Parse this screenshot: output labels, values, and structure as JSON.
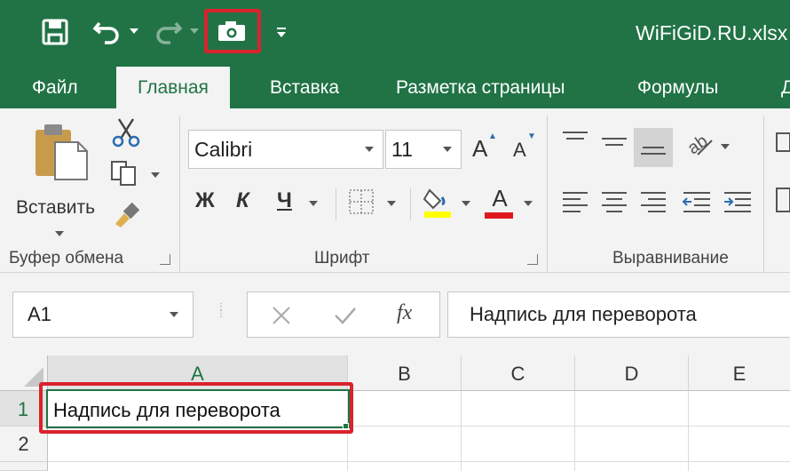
{
  "window": {
    "title": "WiFiGiD.RU.xlsx",
    "accent_color": "#217346",
    "highlight_color": "#d9232d"
  },
  "quick_access": {
    "icons": [
      "save-icon",
      "undo-icon",
      "redo-icon",
      "camera-icon",
      "customize-icon"
    ]
  },
  "tabs": [
    {
      "label": "Файл"
    },
    {
      "label": "Главная",
      "active": true
    },
    {
      "label": "Вставка"
    },
    {
      "label": "Разметка страницы"
    },
    {
      "label": "Формулы"
    },
    {
      "label": "Д"
    }
  ],
  "ribbon": {
    "clipboard": {
      "paste_label": "Вставить",
      "group_label": "Буфер обмена"
    },
    "font": {
      "font_name": "Calibri",
      "font_size": "11",
      "bold_label": "Ж",
      "italic_label": "К",
      "underline_label": "Ч",
      "increase_label": "A",
      "decrease_label": "A",
      "color_label": "A",
      "group_label": "Шрифт"
    },
    "alignment": {
      "group_label": "Выравнивание"
    }
  },
  "formula_bar": {
    "name_box": "A1",
    "fx_label": "fx",
    "formula": "Надпись для переворота"
  },
  "grid": {
    "columns": [
      "A",
      "B",
      "C",
      "D",
      "E"
    ],
    "rows": [
      "1",
      "2"
    ],
    "cell_A1": "Надпись для переворота"
  }
}
